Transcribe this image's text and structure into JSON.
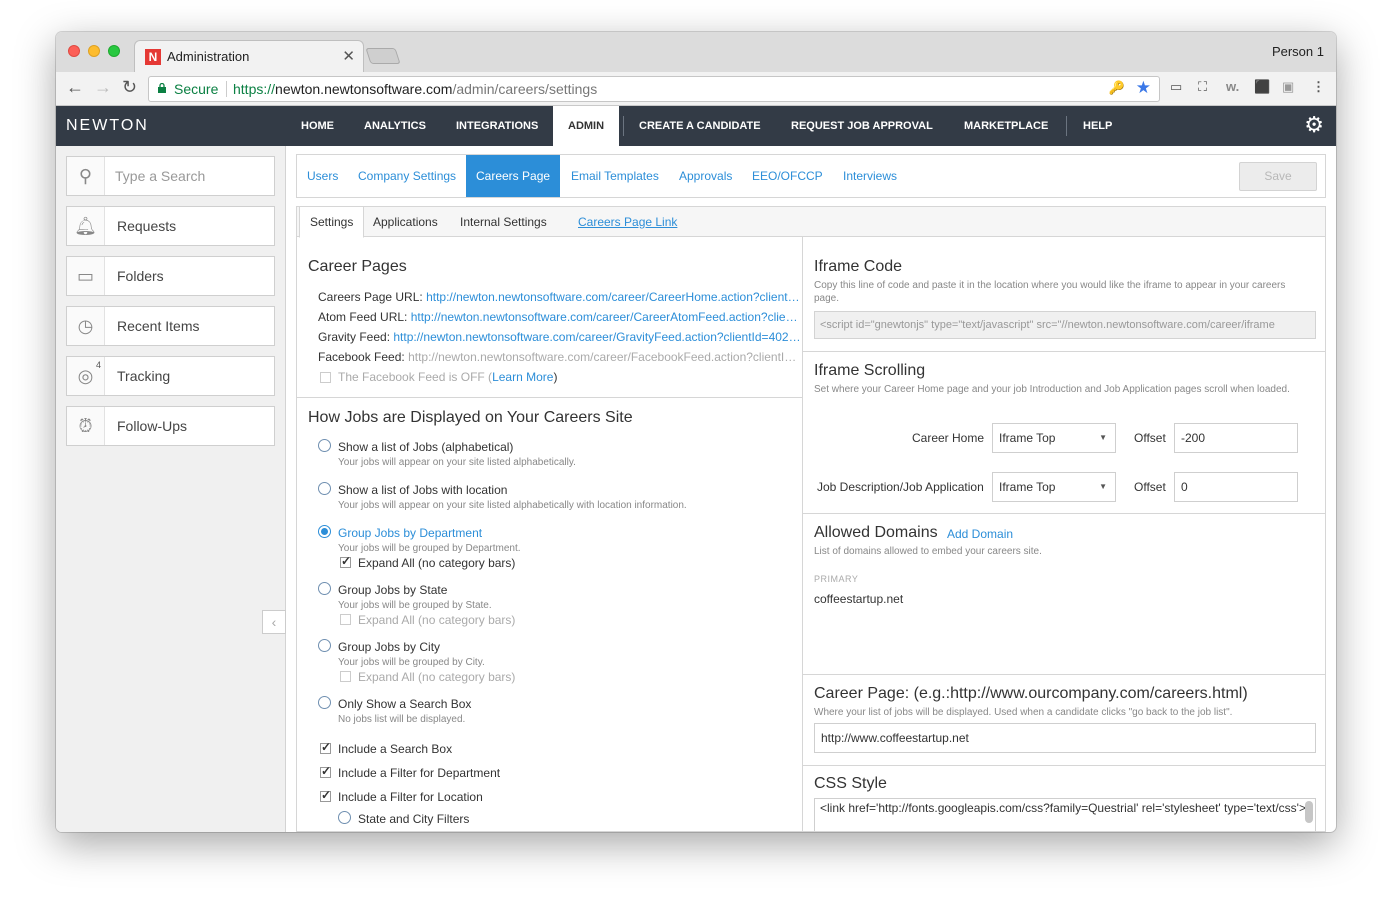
{
  "browser": {
    "tab_title": "Administration",
    "tab_favicon": "N",
    "person": "Person 1",
    "secure_label": "Secure",
    "url_proto": "https://",
    "url_host": "newton.newtonsoftware.com",
    "url_path": "/admin/careers/settings"
  },
  "appnav": {
    "logo": "NEWTON",
    "items": [
      "HOME",
      "ANALYTICS",
      "INTEGRATIONS",
      "ADMIN",
      "CREATE A CANDIDATE",
      "REQUEST JOB APPROVAL",
      "MARKETPLACE",
      "HELP"
    ]
  },
  "sidebar": {
    "search_placeholder": "Type a Search",
    "items": [
      "Requests",
      "Folders",
      "Recent Items",
      "Tracking",
      "Follow-Ups"
    ],
    "tracking_badge": "4"
  },
  "toptabs": {
    "items": [
      "Users",
      "Company Settings",
      "Careers Page",
      "Email Templates",
      "Approvals",
      "EEO/OFCCP",
      "Interviews"
    ],
    "save_label": "Save"
  },
  "subtabs": {
    "items": [
      "Settings",
      "Applications",
      "Internal Settings",
      "Careers Page Link"
    ]
  },
  "career_pages": {
    "title": "Career Pages",
    "careers_url_label": "Careers Page URL:",
    "careers_url": "http://newton.newtonsoftware.com/career/CareerHome.action?client…",
    "atom_label": "Atom Feed URL:",
    "atom_url": "http://newton.newtonsoftware.com/career/CareerAtomFeed.action?clie…",
    "gravity_label": "Gravity Feed:",
    "gravity_url": "http://newton.newtonsoftware.com/career/GravityFeed.action?clientId=402…",
    "facebook_label": "Facebook Feed:",
    "facebook_url": "http://newton.newtonsoftware.com/career/FacebookFeed.action?clientI…",
    "facebook_off": "The Facebook Feed is OFF (",
    "learn_more": "Learn More",
    "close_paren": ")"
  },
  "display": {
    "title": "How Jobs are Displayed on Your Careers Site",
    "options": [
      {
        "label": "Show a list of Jobs (alphabetical)",
        "help": "Your jobs will appear on your site listed alphabetically."
      },
      {
        "label": "Show a list of Jobs with location",
        "help": "Your jobs will appear on your site listed alphabetically with location information."
      },
      {
        "label": "Group Jobs by Department",
        "help": "Your jobs will be grouped by Department."
      },
      {
        "label": "Group Jobs by State",
        "help": "Your jobs will be grouped by State."
      },
      {
        "label": "Group Jobs by City",
        "help": "Your jobs will be grouped by City."
      },
      {
        "label": "Only Show a Search Box",
        "help": "No jobs list will be displayed."
      }
    ],
    "expand_all": "Expand All (no category bars)",
    "include_search": "Include a Search Box",
    "include_department": "Include a Filter for Department",
    "include_location": "Include a Filter for Location",
    "state_city": "State and City Filters"
  },
  "iframe_code": {
    "title": "Iframe Code",
    "help": "Copy this line of code and paste it in the location where you would like the iframe to appear in your careers page.",
    "code": "<script id=\"gnewtonjs\" type=\"text/javascript\" src=\"//newton.newtonsoftware.com/career/iframe"
  },
  "iframe_scrolling": {
    "title": "Iframe Scrolling",
    "help": "Set where your Career Home page and your job Introduction and Job Application pages scroll when loaded.",
    "career_home_label": "Career Home",
    "career_home_value": "Iframe Top",
    "offset_label": "Offset",
    "career_home_offset": "-200",
    "job_desc_label": "Job Description/Job Application",
    "job_desc_value": "Iframe Top",
    "job_desc_offset": "0"
  },
  "allowed_domains": {
    "title": "Allowed Domains",
    "add_domain": "Add Domain",
    "help": "List of domains allowed to embed your careers site.",
    "primary_label": "PRIMARY",
    "domain": "coffeestartup.net"
  },
  "career_page": {
    "title": "Career Page: (e.g.:http://www.ourcompany.com/careers.html)",
    "help": "Where your list of jobs will be displayed. Used when a candidate clicks \"go back to the job list\".",
    "value": "http://www.coffeestartup.net"
  },
  "css_style": {
    "title": "CSS Style",
    "value": "<link href='http://fonts.googleapis.com/css?family=Questrial' rel='stylesheet' type='text/css'>"
  }
}
